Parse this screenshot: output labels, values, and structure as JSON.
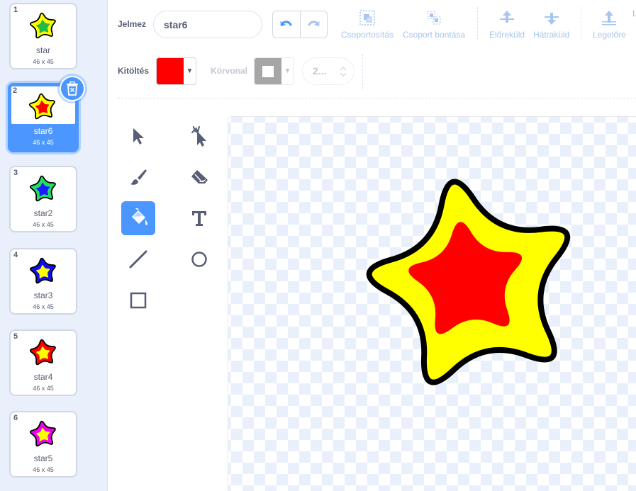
{
  "costumes": [
    {
      "number": "1",
      "name": "star",
      "size": "46 x 45",
      "outer": "#ffff00",
      "inner": "#22bb44",
      "selected": false
    },
    {
      "number": "2",
      "name": "star6",
      "size": "46 x 45",
      "outer": "#ffff00",
      "inner": "#ff0000",
      "selected": true
    },
    {
      "number": "3",
      "name": "star2",
      "size": "46 x 45",
      "outer": "#22dd66",
      "inner": "#1a1aff",
      "selected": false
    },
    {
      "number": "4",
      "name": "star3",
      "size": "46 x 45",
      "outer": "#1010ee",
      "inner": "#ffff00",
      "selected": false
    },
    {
      "number": "5",
      "name": "star4",
      "size": "46 x 45",
      "outer": "#ff0000",
      "inner": "#ffff00",
      "selected": false
    },
    {
      "number": "6",
      "name": "star5",
      "size": "46 x 45",
      "outer": "#ee00ee",
      "inner": "#ffff00",
      "selected": false
    }
  ],
  "toolbar": {
    "costume_label": "Jelmez",
    "costume_name": "star6",
    "group_label": "Csoportosítás",
    "ungroup_label": "Csoport bontása",
    "forward_label": "Előreküld",
    "backward_label": "Hátraküld",
    "front_label": "Legelőre",
    "fill_label": "Kitöltés",
    "outline_label": "Körvonal",
    "stroke_width": "2..."
  },
  "colors": {
    "accent": "#4c97ff",
    "fill": "#ff0000",
    "outline": "#a6a6a6",
    "star_outer": "#ffff00",
    "star_inner": "#ff0000"
  },
  "tools": [
    "select",
    "reshape",
    "brush",
    "eraser",
    "fill",
    "text",
    "line",
    "circle",
    "rectangle"
  ],
  "active_tool": "fill"
}
